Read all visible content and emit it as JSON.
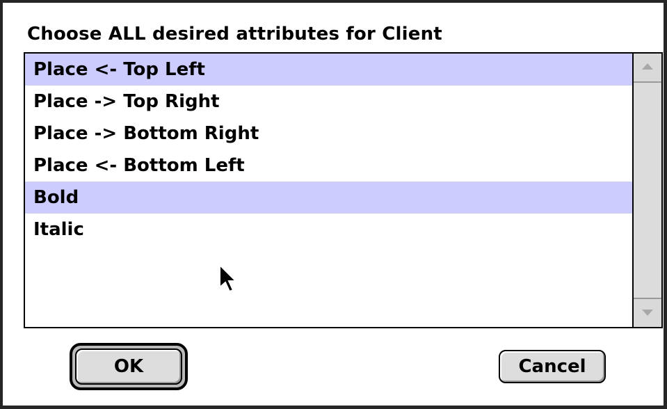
{
  "dialog": {
    "prompt": "Choose ALL desired attributes for Client",
    "items": [
      {
        "label": "Place <- Top Left",
        "selected": true
      },
      {
        "label": "Place -> Top Right",
        "selected": false
      },
      {
        "label": "Place -> Bottom Right",
        "selected": false
      },
      {
        "label": "Place <- Bottom Left",
        "selected": false
      },
      {
        "label": "Bold",
        "selected": true
      },
      {
        "label": "Italic",
        "selected": false
      }
    ],
    "ok_label": "OK",
    "cancel_label": "Cancel"
  },
  "colors": {
    "selection": "#ccccff",
    "button_face": "#dddddd",
    "scrollbar": "#d9d9d9"
  },
  "icons": {
    "scroll_up": "triangle-up-icon",
    "scroll_down": "triangle-down-icon",
    "cursor": "arrow-pointer-icon"
  }
}
